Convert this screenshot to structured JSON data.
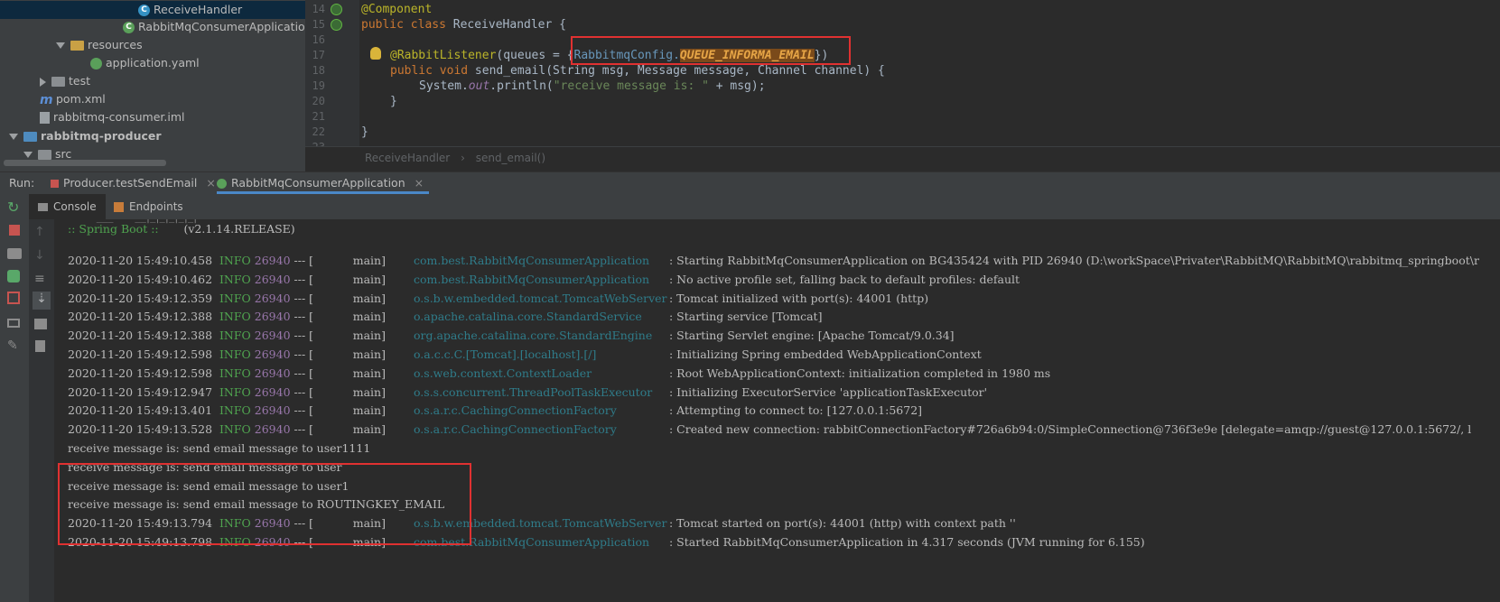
{
  "project_tree": {
    "items": [
      {
        "label": "ReceiveHandler",
        "icon": "class-icon"
      },
      {
        "label": "RabbitMqConsumerApplication",
        "icon": "spring-boot-class-icon"
      },
      {
        "label": "resources",
        "icon": "resources-folder-icon"
      },
      {
        "label": "application.yaml",
        "icon": "yaml-file-icon"
      },
      {
        "label": "test",
        "icon": "folder-icon"
      },
      {
        "label": "pom.xml",
        "icon": "maven-icon"
      },
      {
        "label": "rabbitmq-consumer.iml",
        "icon": "iml-file-icon"
      },
      {
        "label": "rabbitmq-producer",
        "icon": "module-folder-icon"
      },
      {
        "label": "src",
        "icon": "folder-icon"
      }
    ]
  },
  "editor": {
    "line_numbers": [
      "14",
      "15",
      "16",
      "17",
      "18",
      "19",
      "20",
      "21",
      "22",
      "23"
    ],
    "lines": {
      "l14": "@Component",
      "l15_kw": "public class ",
      "l15_name": "ReceiveHandler {",
      "l17_ann": "@RabbitListener",
      "l17_mid": "(queues = {",
      "l17_cls": "RabbitmqConfig.",
      "l17_const": "QUEUE_INFORMA_EMAIL",
      "l17_end": "})",
      "l18_kw": "public void ",
      "l18_rest": "send_email(String msg, Message message, Channel channel) {",
      "l19_a": "System.",
      "l19_out": "out",
      "l19_b": ".println(",
      "l19_str": "\"receive message is: \"",
      "l19_c": " + msg);",
      "l20": "}",
      "l22": "}"
    },
    "breadcrumb": [
      "ReceiveHandler",
      "send_email()"
    ],
    "breadcrumb_sep": "›"
  },
  "run_bar": {
    "label": "Run:",
    "tabs": [
      {
        "label": "Producer.testSendEmail",
        "close": "×"
      },
      {
        "label": "RabbitMqConsumerApplication",
        "close": "×"
      }
    ]
  },
  "sub_tabs": [
    "Console",
    "Endpoints"
  ],
  "console": {
    "banner_prefix": ":: Spring Boot ::",
    "banner_version": "(v2.1.14.RELEASE)",
    "log_lines": [
      {
        "ts": "2020-11-20 15:49:10.458",
        "level": "INFO",
        "pid": "26940",
        "sep": "--- [",
        "thread": "main]",
        "logger": "com.best.RabbitMqConsumerApplication",
        "msg": ": Starting RabbitMqConsumerApplication on BG435424 with PID 26940 (D:\\workSpace\\Privater\\RabbitMQ\\RabbitMQ\\rabbitmq_springboot\\r"
      },
      {
        "ts": "2020-11-20 15:49:10.462",
        "level": "INFO",
        "pid": "26940",
        "sep": "--- [",
        "thread": "main]",
        "logger": "com.best.RabbitMqConsumerApplication",
        "msg": ": No active profile set, falling back to default profiles: default"
      },
      {
        "ts": "2020-11-20 15:49:12.359",
        "level": "INFO",
        "pid": "26940",
        "sep": "--- [",
        "thread": "main]",
        "logger": "o.s.b.w.embedded.tomcat.TomcatWebServer",
        "msg": ": Tomcat initialized with port(s): 44001 (http)"
      },
      {
        "ts": "2020-11-20 15:49:12.388",
        "level": "INFO",
        "pid": "26940",
        "sep": "--- [",
        "thread": "main]",
        "logger": "o.apache.catalina.core.StandardService",
        "msg": ": Starting service [Tomcat]"
      },
      {
        "ts": "2020-11-20 15:49:12.388",
        "level": "INFO",
        "pid": "26940",
        "sep": "--- [",
        "thread": "main]",
        "logger": "org.apache.catalina.core.StandardEngine",
        "msg": ": Starting Servlet engine: [Apache Tomcat/9.0.34]"
      },
      {
        "ts": "2020-11-20 15:49:12.598",
        "level": "INFO",
        "pid": "26940",
        "sep": "--- [",
        "thread": "main]",
        "logger": "o.a.c.c.C.[Tomcat].[localhost].[/]",
        "msg": ": Initializing Spring embedded WebApplicationContext"
      },
      {
        "ts": "2020-11-20 15:49:12.598",
        "level": "INFO",
        "pid": "26940",
        "sep": "--- [",
        "thread": "main]",
        "logger": "o.s.web.context.ContextLoader",
        "msg": ": Root WebApplicationContext: initialization completed in 1980 ms"
      },
      {
        "ts": "2020-11-20 15:49:12.947",
        "level": "INFO",
        "pid": "26940",
        "sep": "--- [",
        "thread": "main]",
        "logger": "o.s.s.concurrent.ThreadPoolTaskExecutor",
        "msg": ": Initializing ExecutorService 'applicationTaskExecutor'"
      },
      {
        "ts": "2020-11-20 15:49:13.401",
        "level": "INFO",
        "pid": "26940",
        "sep": "--- [",
        "thread": "main]",
        "logger": "o.s.a.r.c.CachingConnectionFactory",
        "msg": ": Attempting to connect to: [127.0.0.1:5672]"
      },
      {
        "ts": "2020-11-20 15:49:13.528",
        "level": "INFO",
        "pid": "26940",
        "sep": "--- [",
        "thread": "main]",
        "logger": "o.s.a.r.c.CachingConnectionFactory",
        "msg": ": Created new connection: rabbitConnectionFactory#726a6b94:0/SimpleConnection@736f3e9e [delegate=amqp://guest@127.0.0.1:5672/, l"
      }
    ],
    "received": [
      "receive message is: send email message to user1111",
      "receive message is: send email message to user",
      "receive message is: send email message to user1",
      "receive message is: send email message to ROUTINGKEY_EMAIL"
    ],
    "tail_lines": [
      {
        "ts": "2020-11-20 15:49:13.794",
        "level": "INFO",
        "pid": "26940",
        "sep": "--- [",
        "thread": "main]",
        "logger": "o.s.b.w.embedded.tomcat.TomcatWebServer",
        "msg": ": Tomcat started on port(s): 44001 (http) with context path ''"
      },
      {
        "ts": "2020-11-20 15:49:13.798",
        "level": "INFO",
        "pid": "26940",
        "sep": "--- [",
        "thread": "main]",
        "logger": "com.best.RabbitMqConsumerApplication",
        "msg": ": Started RabbitMqConsumerApplication in 4.317 seconds (JVM running for 6.155)"
      }
    ]
  },
  "colors": {
    "highlight_box": "#e03131",
    "info": "#4fa34f",
    "pid": "#9876aa",
    "logger": "#2f7c8a"
  }
}
